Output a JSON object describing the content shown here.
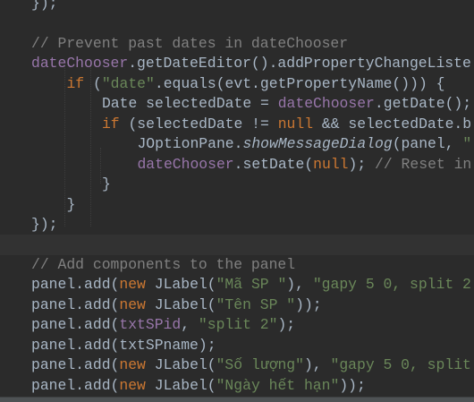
{
  "editor": {
    "language": "java",
    "colors": {
      "background": "#2b2b2b",
      "text": "#a9b7c6",
      "keyword": "#cc7832",
      "string": "#6a8759",
      "comment": "#808080",
      "field": "#9876aa",
      "current_line": "#323232"
    },
    "current_line_index": 12,
    "lines": [
      {
        "indent": 0,
        "tokens": [
          [
            "});",
            ""
          ]
        ]
      },
      {
        "indent": 0,
        "tokens": []
      },
      {
        "indent": 0,
        "tokens": [
          [
            "// Prevent past dates in dateChooser",
            "com"
          ]
        ]
      },
      {
        "indent": 0,
        "tokens": [
          [
            "dateChooser",
            "field"
          ],
          [
            ".getDateEditor().addPropertyChangeListe",
            ""
          ]
        ]
      },
      {
        "indent": 1,
        "tokens": [
          [
            "if ",
            "kw"
          ],
          [
            "(",
            ""
          ],
          [
            "\"date\"",
            "str"
          ],
          [
            ".equals(evt.getPropertyName())) {",
            ""
          ]
        ]
      },
      {
        "indent": 2,
        "tokens": [
          [
            "Date selectedDate = ",
            ""
          ],
          [
            "dateChooser",
            "field"
          ],
          [
            ".getDate();",
            ""
          ]
        ]
      },
      {
        "indent": 2,
        "tokens": [
          [
            "if ",
            "kw"
          ],
          [
            "(selectedDate != ",
            ""
          ],
          [
            "null",
            "kw"
          ],
          [
            " && selectedDate.b",
            ""
          ]
        ]
      },
      {
        "indent": 3,
        "tokens": [
          [
            "JOptionPane.",
            ""
          ],
          [
            "showMessageDialog",
            "italic"
          ],
          [
            "(panel, ",
            ""
          ],
          [
            "\"",
            "str"
          ]
        ]
      },
      {
        "indent": 3,
        "tokens": [
          [
            "dateChooser",
            "field"
          ],
          [
            ".setDate(",
            ""
          ],
          [
            "null",
            "kw"
          ],
          [
            "); ",
            ""
          ],
          [
            "// Reset in",
            "com"
          ]
        ]
      },
      {
        "indent": 2,
        "tokens": [
          [
            "}",
            ""
          ]
        ]
      },
      {
        "indent": 1,
        "tokens": [
          [
            "}",
            ""
          ]
        ]
      },
      {
        "indent": 0,
        "tokens": [
          [
            "});",
            ""
          ]
        ]
      },
      {
        "indent": 0,
        "tokens": []
      },
      {
        "indent": 0,
        "tokens": [
          [
            "// Add components to the panel",
            "com"
          ]
        ]
      },
      {
        "indent": 0,
        "tokens": [
          [
            "panel.add(",
            ""
          ],
          [
            "new ",
            "kw"
          ],
          [
            "JLabel(",
            ""
          ],
          [
            "\"Mã SP \"",
            "str"
          ],
          [
            "), ",
            ""
          ],
          [
            "\"gapy 5 0, split 2",
            "str"
          ]
        ]
      },
      {
        "indent": 0,
        "tokens": [
          [
            "panel.add(",
            ""
          ],
          [
            "new ",
            "kw"
          ],
          [
            "JLabel(",
            ""
          ],
          [
            "\"Tên SP \"",
            "str"
          ],
          [
            "));",
            ""
          ]
        ]
      },
      {
        "indent": 0,
        "tokens": [
          [
            "panel.add(",
            ""
          ],
          [
            "txtSPid",
            "field"
          ],
          [
            ", ",
            ""
          ],
          [
            "\"split 2\"",
            "str"
          ],
          [
            ");",
            ""
          ]
        ]
      },
      {
        "indent": 0,
        "tokens": [
          [
            "panel.add(txtSPname);",
            ""
          ]
        ]
      },
      {
        "indent": 0,
        "tokens": [
          [
            "panel.add(",
            ""
          ],
          [
            "new ",
            "kw"
          ],
          [
            "JLabel(",
            ""
          ],
          [
            "\"Số lượng\"",
            "str"
          ],
          [
            "), ",
            ""
          ],
          [
            "\"gapy 5 0, split",
            "str"
          ]
        ]
      },
      {
        "indent": 0,
        "tokens": [
          [
            "panel.add(",
            ""
          ],
          [
            "new ",
            "kw"
          ],
          [
            "JLabel(",
            ""
          ],
          [
            "\"Ngày hết hạn\"",
            "str"
          ],
          [
            "));",
            ""
          ]
        ]
      }
    ]
  }
}
